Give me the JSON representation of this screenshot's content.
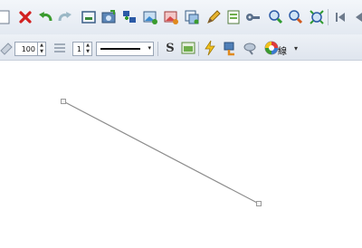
{
  "toolbar_primary": {
    "icons": [
      "page-icon",
      "delete-icon",
      "undo-icon",
      "redo-icon",
      "insert-frame-icon",
      "photo-icon",
      "node-add-icon",
      "image-insert-icon",
      "image-edit-icon",
      "layer-icon",
      "pencil-icon",
      "document-icon",
      "key-icon",
      "zoom-in-icon",
      "zoom-out-icon",
      "zoom-fit-icon",
      "first-page-icon",
      "previous-page-icon"
    ]
  },
  "toolbar_secondary": {
    "line_width_value": "100",
    "line_spacing_value": "1",
    "line_style": "solid",
    "text_style_label": "S",
    "color_label": "線",
    "dropdown_arrow": "▾"
  },
  "canvas": {
    "line_color": "#8c8c8c",
    "handle_color": "#9a9a9a"
  }
}
